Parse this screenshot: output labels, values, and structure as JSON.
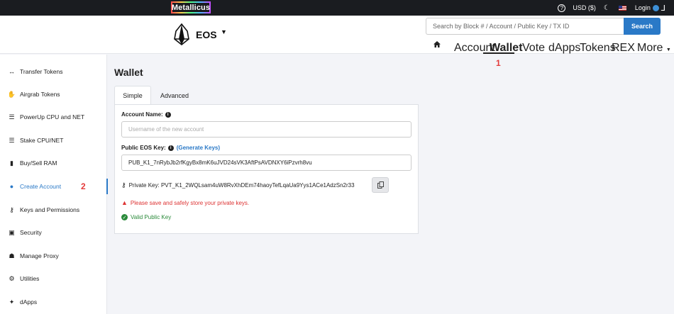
{
  "topbar": {
    "brand": "Metallicus",
    "currency": "USD ($)",
    "login": "Login"
  },
  "header": {
    "chain_title": "EOS",
    "search_placeholder": "Search by Block # / Account / Public Key / TX ID",
    "search_button": "Search",
    "nav": [
      "Account",
      "Wallet",
      "Vote",
      "dApps",
      "Tokens",
      "REX",
      "More"
    ],
    "active_nav": "Wallet"
  },
  "sidebar": {
    "items": [
      {
        "label": "Transfer Tokens",
        "icon": "transfer-icon"
      },
      {
        "label": "Airgrab Tokens",
        "icon": "hand-icon"
      },
      {
        "label": "PowerUp CPU and NET",
        "icon": "server-icon"
      },
      {
        "label": "Stake CPU/NET",
        "icon": "server-icon"
      },
      {
        "label": "Buy/Sell RAM",
        "icon": "memory-icon"
      },
      {
        "label": "Create Account",
        "icon": "user-icon"
      },
      {
        "label": "Keys and Permissions",
        "icon": "key-icon"
      },
      {
        "label": "Security",
        "icon": "lock-icon"
      },
      {
        "label": "Manage Proxy",
        "icon": "users-icon"
      },
      {
        "label": "Utilities",
        "icon": "gear-icon"
      },
      {
        "label": "dApps",
        "icon": "gamepad-icon"
      }
    ],
    "active": "Create Account"
  },
  "annotations": {
    "marker_1": "1",
    "marker_2": "2"
  },
  "main": {
    "title": "Wallet",
    "tabs": [
      "Simple",
      "Advanced"
    ],
    "account_name_label": "Account Name:",
    "account_name_placeholder": "Username of the new account",
    "public_key_label": "Public EOS Key:",
    "generate_keys": "(Generate Keys)",
    "public_key_value": "PUB_K1_7nRybJb2rfKgyBx8mK6uJVD24sVK3AftPsAVDNXY6iPzvrh8vu",
    "private_key_label": "Private Key:",
    "private_key_value": "PVT_K1_2WQLsam4uW8RvXhDEm74haoyTefLqaUa9Yys1ACe1AdzSn2r33",
    "warning": "Please save and safely store your private keys.",
    "valid": "Valid Public Key"
  },
  "colors": {
    "accent": "#2a79c7",
    "warning": "#d33333",
    "success": "#2a8a3a",
    "marker": "#e43b3b"
  }
}
